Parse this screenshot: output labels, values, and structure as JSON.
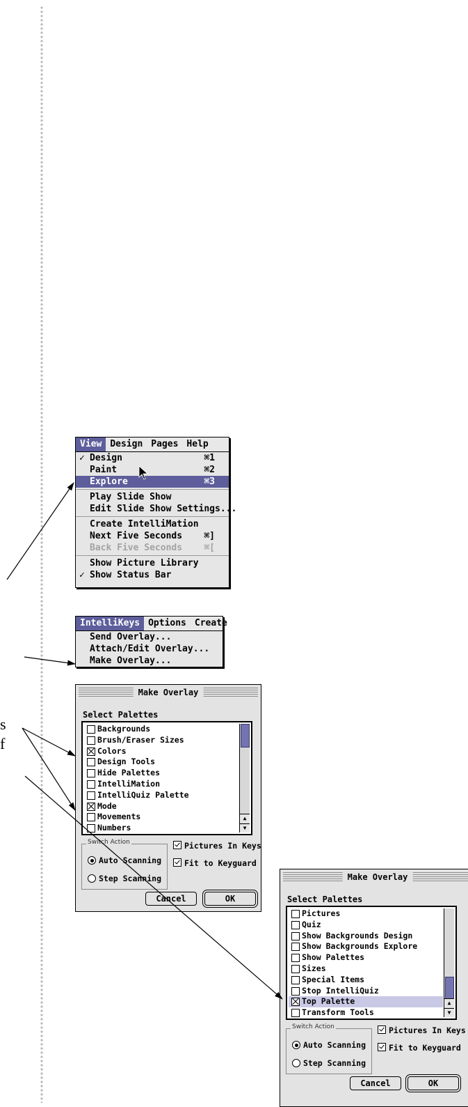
{
  "margin_fragments": [
    "s",
    "f"
  ],
  "view_menu": {
    "menubar": [
      "View",
      "Design",
      "Pages",
      "Help"
    ],
    "items": [
      {
        "label": "Design",
        "check": "✓",
        "shortcut": "⌘1"
      },
      {
        "label": "Paint",
        "check": "",
        "shortcut": "⌘2"
      },
      {
        "label": "Explore",
        "check": "",
        "shortcut": "⌘3"
      },
      {
        "label": "Play Slide Show",
        "check": "",
        "shortcut": ""
      },
      {
        "label": "Edit Slide Show Settings...",
        "check": "",
        "shortcut": ""
      },
      {
        "label": "Create IntelliMation",
        "check": "",
        "shortcut": ""
      },
      {
        "label": "Next Five Seconds",
        "check": "",
        "shortcut": "⌘]"
      },
      {
        "label": "Back Five Seconds",
        "check": "",
        "shortcut": "⌘["
      },
      {
        "label": "Show Picture Library",
        "check": "",
        "shortcut": ""
      },
      {
        "label": "Show Status Bar",
        "check": "✓",
        "shortcut": ""
      }
    ]
  },
  "intellikeys_menu": {
    "menubar": [
      "IntelliKeys",
      "Options",
      "Create"
    ],
    "items": [
      "Send Overlay...",
      "Attach/Edit Overlay...",
      "Make Overlay..."
    ]
  },
  "dialog1": {
    "title": "Make Overlay",
    "section_label": "Select Palettes",
    "items": [
      {
        "label": "Backgrounds",
        "checked": false
      },
      {
        "label": "Brush/Eraser Sizes",
        "checked": false
      },
      {
        "label": "Colors",
        "checked": true
      },
      {
        "label": "Design Tools",
        "checked": false
      },
      {
        "label": "Hide Palettes",
        "checked": false
      },
      {
        "label": "IntelliMation",
        "checked": false
      },
      {
        "label": "IntelliQuiz Palette",
        "checked": false
      },
      {
        "label": "Mode",
        "checked": true
      },
      {
        "label": "Movements",
        "checked": false
      },
      {
        "label": "Numbers",
        "checked": false
      }
    ],
    "switch_action_label": "Switch Action",
    "auto_scanning": "Auto Scanning",
    "step_scanning": "Step Scanning",
    "pictures_in_keys": "Pictures In Keys",
    "fit_to_keyguard": "Fit to Keyguard",
    "cancel": "Cancel",
    "ok": "OK"
  },
  "dialog2": {
    "title": "Make Overlay",
    "section_label": "Select Palettes",
    "items": [
      {
        "label": "Pictures",
        "checked": false
      },
      {
        "label": "Quiz",
        "checked": false
      },
      {
        "label": "Show Backgrounds Design",
        "checked": false
      },
      {
        "label": "Show Backgrounds Explore",
        "checked": false
      },
      {
        "label": "Show Palettes",
        "checked": false
      },
      {
        "label": "Sizes",
        "checked": false
      },
      {
        "label": "Special Items",
        "checked": false
      },
      {
        "label": "Stop IntelliQuiz",
        "checked": false
      },
      {
        "label": "Top Palette",
        "checked": true
      },
      {
        "label": "Transform Tools",
        "checked": false
      }
    ],
    "switch_action_label": "Switch Action",
    "auto_scanning": "Auto Scanning",
    "step_scanning": "Step Scanning",
    "pictures_in_keys": "Pictures In Keys",
    "fit_to_keyguard": "Fit to Keyguard",
    "cancel": "Cancel",
    "ok": "OK"
  }
}
